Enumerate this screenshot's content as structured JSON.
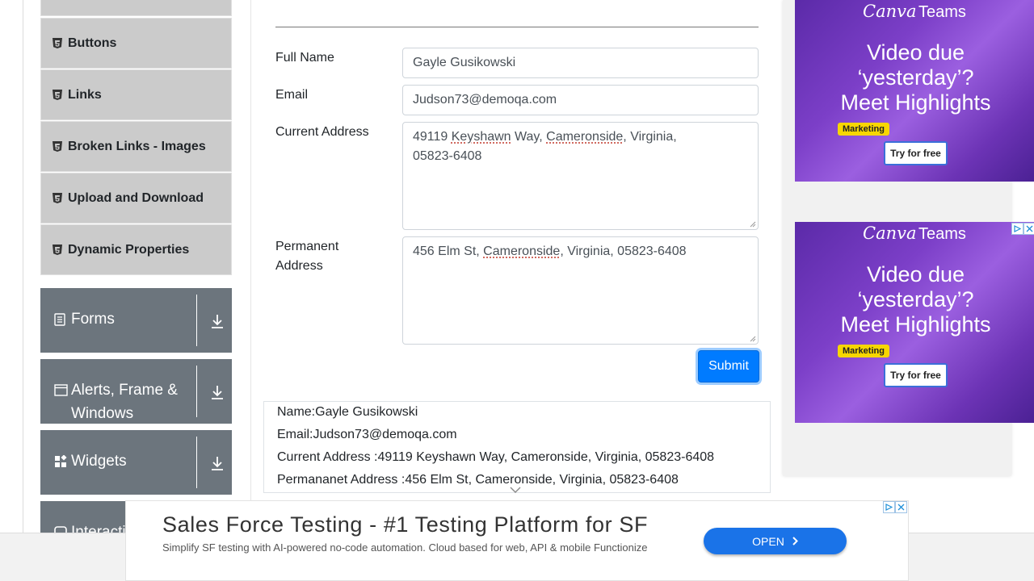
{
  "sidebar": {
    "elements_items": [
      {
        "label": "Buttons"
      },
      {
        "label": "Links"
      },
      {
        "label": "Broken Links - Images"
      },
      {
        "label": "Upload and Download"
      },
      {
        "label": "Dynamic Properties"
      }
    ],
    "groups": [
      {
        "label": "Forms",
        "icon": "document-icon"
      },
      {
        "label": "Alerts, Frame & Windows",
        "label_line1": "Alerts, Frame &",
        "label_line2": "Windows",
        "icon": "window-icon"
      },
      {
        "label": "Widgets",
        "icon": "widgets-icon"
      },
      {
        "label": "Interactions",
        "visible_text": "Interacti",
        "icon": "interactions-icon"
      }
    ]
  },
  "form": {
    "full_name_label": "Full Name",
    "full_name_value": "Gayle Gusikowski",
    "email_label": "Email",
    "email_value": "Judson73@demoqa.com",
    "current_address_label": "Current Address",
    "current_address": {
      "p1": "49119 ",
      "w1": "Keyshawn",
      "p2": " Way, ",
      "w2": "Cameronside",
      "p3": ", Virginia,",
      "line2": "05823-6408"
    },
    "permanent_address_label_1": "Permanent",
    "permanent_address_label_2": "Address",
    "permanent_address": {
      "p1": "456 Elm St, ",
      "w1": "Cameronside",
      "p2": ", Virginia, 05823-6408"
    },
    "submit_label": "Submit"
  },
  "output": {
    "name": "Name:Gayle Gusikowski",
    "email": "Email:Judson73@demoqa.com",
    "current_address": "Current Address :49119 Keyshawn Way, Cameronside, Virginia, 05823-6408",
    "permanent_address": "Permananet Address :456 Elm St, Cameronside, Virginia, 05823-6408"
  },
  "ads": {
    "side": [
      {
        "brand": "Canva",
        "brand_suffix": "Teams",
        "headline_1": "Video due",
        "headline_2": "‘yesterday’?",
        "headline_3": "Meet Highlights",
        "tag": "Marketing",
        "cta": "Try for free"
      },
      {
        "brand": "Canva",
        "brand_suffix": "Teams",
        "headline_1": "Video due",
        "headline_2": "‘yesterday’?",
        "headline_3": "Meet Highlights",
        "tag": "Marketing",
        "cta": "Try for free"
      }
    ],
    "bottom": {
      "title": "Sales Force Testing - #1 Testing Platform for SF",
      "description": "Simplify SF testing with AI-powered no-code automation. Cloud based for web, API & mobile Functionize",
      "cta": "OPEN"
    }
  },
  "colors": {
    "primary": "#007bff",
    "sidebar_group": "#6c757d",
    "sidebar_item": "#cbcbcb",
    "ad_purple": "#7c3fc8"
  }
}
